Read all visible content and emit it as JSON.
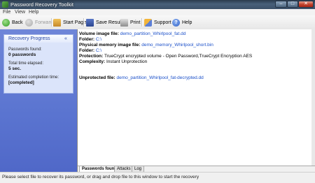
{
  "window": {
    "title": "Password Recovery Toolkit"
  },
  "menu": [
    "File",
    "View",
    "Help"
  ],
  "toolbar": {
    "back": "Back",
    "forward": "Forward",
    "start_page": "Start Page",
    "save_results": "Save Results",
    "print": "Print",
    "support": "Support",
    "help": "Help"
  },
  "progress": {
    "title": "Recovery Progress",
    "collapse_glyph": "«",
    "passwords_found_label": "Passwords found:",
    "passwords_found_value": "0 passwords",
    "time_elapsed_label": "Total time elapsed:",
    "time_elapsed_value": "5 sec.",
    "completion_label": "Estimated completion time:",
    "completion_value": "[completed]"
  },
  "details": {
    "volume_image_label": "Volume image file:",
    "volume_image_value": "demo_partition_Whirlpool_fat.dd",
    "folder1_label": "Folder:",
    "folder1_value": "C:\\",
    "memory_image_label": "Physical memory image file:",
    "memory_image_value": "demo_memory_Whirlpool_short.bin",
    "folder2_label": "Folder:",
    "folder2_value": "C:\\",
    "protection_label": "Protection:",
    "protection_value": "TrueCrypt encrypted volume - Open Password,TrueCrypt Encryption AES",
    "complexity_label": "Complexity:",
    "complexity_value": "Instant Unprotection",
    "unprotected_label": "Unprotected file:",
    "unprotected_value": "demo_partition_Whirlpool_fat-decrypted.dd"
  },
  "tabs": [
    "Passwords found",
    "Attacks",
    "Log"
  ],
  "status": "Please select file to recover its password, or drag and drop file to this window to start the recovery",
  "colors": {
    "panel_blue": "#5a74d0",
    "link": "#1a4fc9"
  }
}
